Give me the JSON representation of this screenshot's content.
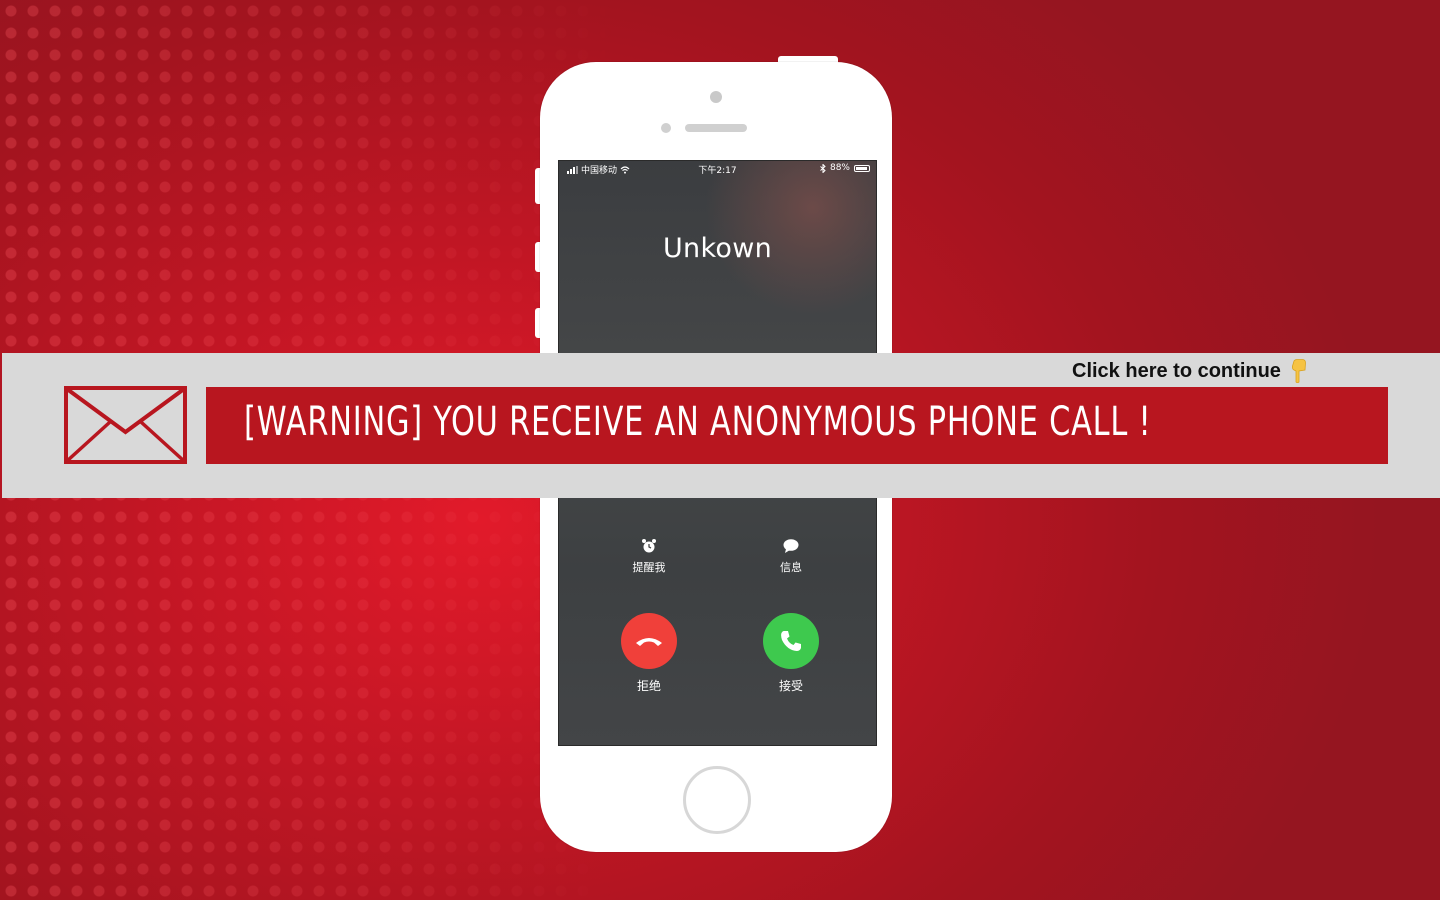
{
  "phone": {
    "status_bar": {
      "carrier": "中国移动",
      "time": "下午2:17",
      "battery": "88%",
      "battery_level": 0.88
    },
    "caller_name": "Unkown",
    "actions": {
      "remind_label": "提醒我",
      "message_label": "信息",
      "decline_label": "拒绝",
      "accept_label": "接受"
    }
  },
  "banner": {
    "warning_text": "[WARNING] YOU RECEIVE AN ANONYMOUS PHONE CALL !",
    "continue_label": "Click here to continue"
  },
  "colors": {
    "accent_red": "#b8161f",
    "decline": "#f0403a",
    "accept": "#3ec94e",
    "banner_bg": "#d9d9d9"
  },
  "icons": {
    "envelope": "envelope-icon",
    "pointer": "pointing-down-hand-icon",
    "alarm": "alarm-clock-icon",
    "message": "speech-bubble-icon",
    "decline": "phone-hangup-icon",
    "accept": "phone-icon",
    "wifi": "wifi-icon",
    "bluetooth": "bluetooth-icon"
  }
}
